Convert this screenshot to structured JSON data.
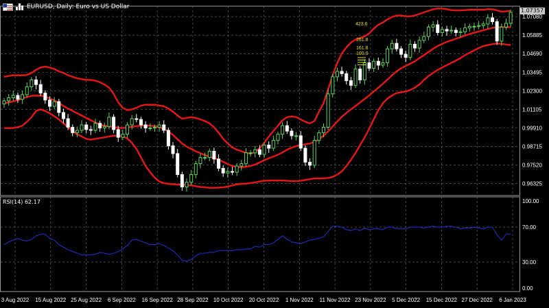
{
  "header": {
    "title": "EURUSD, Daily:  Euro vs US Dollar"
  },
  "colors": {
    "background": "#000000",
    "grid": "#6e6e6e",
    "bull": "#5cd65c",
    "bear": "#ffffff",
    "bollinger": "#e01818",
    "rsi": "#1c2bb8",
    "fib": "#e8e000",
    "axis_text": "#ffffff"
  },
  "current_price_label": "1.07357",
  "rsi_label": "RSI(14) 62.17",
  "chart_data": [
    {
      "type": "candlestick",
      "title": "EURUSD, Daily:  Euro vs US Dollar",
      "ylim": [
        0.9555,
        1.0775
      ],
      "y_ticks": [
        "1.07080",
        "1.05885",
        "1.04690",
        "1.03495",
        "1.02300",
        "1.01105",
        "0.99910",
        "0.98715",
        "0.97520",
        "0.96325"
      ],
      "x_ticks": [
        "3 Aug 2022",
        "15 Aug 2022",
        "25 Aug 2022",
        "6 Sep 2022",
        "16 Sep 2022",
        "28 Sep 2022",
        "10 Oct 2022",
        "20 Oct 2022",
        "1 Nov 2022",
        "11 Nov 2022",
        "23 Nov 2022",
        "5 Dec 2022",
        "15 Dec 2022",
        "27 Dec 2022",
        "6 Jan 2023"
      ],
      "series": [
        {
          "type": "candles",
          "close": [
            1.0165,
            1.0185,
            1.02,
            1.0175,
            1.0205,
            1.0255,
            1.03,
            1.027,
            1.0215,
            1.017,
            1.013,
            1.016,
            1.009,
            1.005,
            0.9995,
            0.996,
            0.9975,
            1.001,
            0.998,
            0.9975,
            1.002,
            0.999,
            1.0,
            1.006,
            0.998,
            0.993,
            0.995,
            1.001,
            1.005,
            1.0045,
            1.001,
            0.999,
            0.999,
            0.9995,
            1.001,
            0.9975,
            0.9875,
            0.9825,
            0.969,
            0.961,
            0.964,
            0.969,
            0.976,
            0.98,
            0.98,
            0.984,
            0.979,
            0.973,
            0.97,
            0.971,
            0.9705,
            0.9745,
            0.976,
            0.983,
            0.983,
            0.985,
            0.982,
            0.988,
            0.986,
            0.991,
            0.995,
            1.0005,
            0.997,
            0.994,
            0.994,
            0.986,
            0.977,
            0.975,
            0.991,
            0.996,
            0.9995,
            1.021,
            1.032,
            1.0355,
            1.034,
            1.0295,
            1.0265,
            1.037,
            1.03,
            1.041,
            1.0375,
            1.042,
            1.0395,
            1.041,
            1.05,
            1.0535,
            1.05,
            1.0465,
            1.0445,
            1.053,
            1.0505,
            1.0555,
            1.058,
            1.064,
            1.0655,
            1.0605,
            1.0625,
            1.0615,
            1.062,
            1.0605,
            1.061,
            1.0635,
            1.0645,
            1.0645,
            1.065,
            1.066,
            1.07,
            1.0675,
            1.055,
            1.064,
            1.0665,
            1.0735
          ]
        },
        {
          "name": "Bollinger Upper",
          "values": [
            1.032,
            1.0325,
            1.033,
            1.033,
            1.033,
            1.0332,
            1.0345,
            1.0365,
            1.038,
            1.0385,
            1.038,
            1.037,
            1.0355,
            1.0345,
            1.033,
            1.032,
            1.031,
            1.0305,
            1.03,
            1.03,
            1.0295,
            1.0285,
            1.027,
            1.025,
            1.021,
            1.0155,
            1.012,
            1.0105,
            1.011,
            1.012,
            1.0135,
            1.014,
            1.014,
            1.014,
            1.0135,
            1.013,
            1.0115,
            1.0095,
            1.007,
            1.005,
            1.0055,
            1.006,
            1.0055,
            1.0045,
            1.0035,
            1.002,
            0.9995,
            0.996,
            0.992,
            0.989,
            0.9865,
            0.985,
            0.984,
            0.983,
            0.9825,
            0.9835,
            0.986,
            0.9895,
            0.9935,
            0.997,
            1.0005,
            1.004,
            1.006,
            1.0065,
            1.006,
            1.0045,
            1.003,
            1.002,
            1.0035,
            1.0095,
            1.015,
            1.024,
            1.033,
            1.041,
            1.047,
            1.051,
            1.054,
            1.056,
            1.057,
            1.058,
            1.06,
            1.063,
            1.0655,
            1.067,
            1.069,
            1.0705,
            1.0715,
            1.0715,
            1.071,
            1.071,
            1.0715,
            1.0725,
            1.0735,
            1.0745,
            1.0755,
            1.076,
            1.076,
            1.0755,
            1.075,
            1.0748,
            1.0748,
            1.075,
            1.0752,
            1.0752,
            1.0752,
            1.0752,
            1.0755,
            1.0755,
            1.0748,
            1.074,
            1.0742,
            1.0745
          ]
        },
        {
          "name": "Bollinger Middle",
          "values": [
            1.015,
            1.0155,
            1.0162,
            1.017,
            1.018,
            1.019,
            1.0197,
            1.0199,
            1.0198,
            1.0192,
            1.018,
            1.0168,
            1.015,
            1.0132,
            1.0115,
            1.01,
            1.0085,
            1.007,
            1.0055,
            1.004,
            1.0025,
            1.0012,
            1.0004,
            1.0,
            0.9995,
            0.9992,
            0.999,
            0.9993,
            0.9998,
            1.0002,
            1.0005,
            1.0006,
            1.0005,
            1.0002,
            0.9995,
            0.9985,
            0.9968,
            0.9945,
            0.9918,
            0.989,
            0.987,
            0.9855,
            0.984,
            0.9828,
            0.9815,
            0.9805,
            0.9795,
            0.9785,
            0.9772,
            0.9758,
            0.9745,
            0.9738,
            0.9738,
            0.974,
            0.9745,
            0.9755,
            0.9768,
            0.9782,
            0.9795,
            0.9806,
            0.9818,
            0.9833,
            0.985,
            0.9863,
            0.9873,
            0.988,
            0.9885,
            0.989,
            0.99,
            0.9918,
            0.994,
            0.9968,
            1.0,
            1.0032,
            1.0062,
            1.0087,
            1.011,
            1.0132,
            1.0155,
            1.0177,
            1.02,
            1.0225,
            1.025,
            1.0275,
            1.0302,
            1.033,
            1.0355,
            1.0375,
            1.039,
            1.0405,
            1.042,
            1.044,
            1.046,
            1.048,
            1.05,
            1.0518,
            1.0532,
            1.0545,
            1.0555,
            1.0565,
            1.0575,
            1.0585,
            1.0595,
            1.0605,
            1.0612,
            1.062,
            1.0628,
            1.0635,
            1.064,
            1.064,
            1.064,
            1.064
          ]
        },
        {
          "name": "Bollinger Lower",
          "values": [
            0.999,
            0.999,
            0.999,
            0.9995,
            1.0005,
            1.003,
            1.006,
            1.01,
            1.011,
            1.01,
            1.0085,
            1.0065,
            1.0045,
            1.002,
            0.9995,
            0.997,
            0.995,
            0.9935,
            0.992,
            0.9915,
            0.992,
            0.9925,
            0.993,
            0.9935,
            0.994,
            0.994,
            0.9937,
            0.9922,
            0.9895,
            0.9855,
            0.98,
            0.9745,
            0.9705,
            0.967,
            0.9645,
            0.9635,
            0.963,
            0.9628,
            0.9625,
            0.9625,
            0.9623,
            0.962,
            0.9615,
            0.961,
            0.9608,
            0.9605,
            0.9605,
            0.9606,
            0.9608,
            0.9612,
            0.962,
            0.9627,
            0.963,
            0.9632,
            0.9635,
            0.964,
            0.9645,
            0.965,
            0.9652,
            0.9652,
            0.9652,
            0.9652,
            0.965,
            0.9648,
            0.9648,
            0.965,
            0.9655,
            0.966,
            0.9665,
            0.9665,
            0.9665,
            0.9668,
            0.9675,
            0.969,
            0.971,
            0.9745,
            0.9785,
            0.983,
            0.988,
            0.993,
            0.9985,
            1.0045,
            1.0105,
            1.015,
            1.018,
            1.02,
            1.0215,
            1.022,
            1.0225,
            1.0235,
            1.025,
            1.027,
            1.03,
            1.0325,
            1.0345,
            1.0365,
            1.038,
            1.0395,
            1.041,
            1.0425,
            1.044,
            1.046,
            1.0475,
            1.049,
            1.0505,
            1.0518,
            1.0525,
            1.053,
            1.0535,
            1.0532,
            1.0528,
            1.0525
          ]
        }
      ]
    },
    {
      "type": "line",
      "title": "RSI(14) 62.17",
      "ylim": [
        0,
        100
      ],
      "y_ticks": [
        "100.00",
        "70.00",
        "30.00",
        "0.00"
      ],
      "series": [
        {
          "name": "RSI(14)",
          "values": [
            50,
            53,
            55,
            57,
            55,
            54,
            56,
            60,
            62,
            62,
            57,
            55,
            50,
            47,
            44,
            42,
            40,
            38,
            38,
            38,
            39,
            41,
            40,
            39,
            40,
            42,
            45,
            49,
            55,
            56,
            54,
            52,
            50,
            50,
            51,
            49,
            46,
            43,
            38,
            32,
            31,
            33,
            37,
            40,
            40,
            41,
            41,
            43,
            43,
            43,
            43,
            44,
            44,
            45,
            45,
            48,
            47,
            50,
            50,
            52,
            56,
            60,
            56,
            53,
            52,
            51,
            53,
            55,
            56,
            57,
            59,
            65,
            71,
            71,
            70,
            67,
            66,
            68,
            66,
            69,
            67,
            68,
            68,
            67,
            70,
            70,
            68,
            68,
            68,
            70,
            70,
            70,
            69,
            70,
            71,
            70,
            70,
            71,
            71,
            70,
            68,
            69,
            69,
            70,
            69,
            68,
            70,
            70,
            61,
            55,
            62,
            62
          ]
        }
      ]
    }
  ],
  "fibonacci_levels": [
    "423.6",
    "261.8",
    "161.8",
    "100.0"
  ]
}
